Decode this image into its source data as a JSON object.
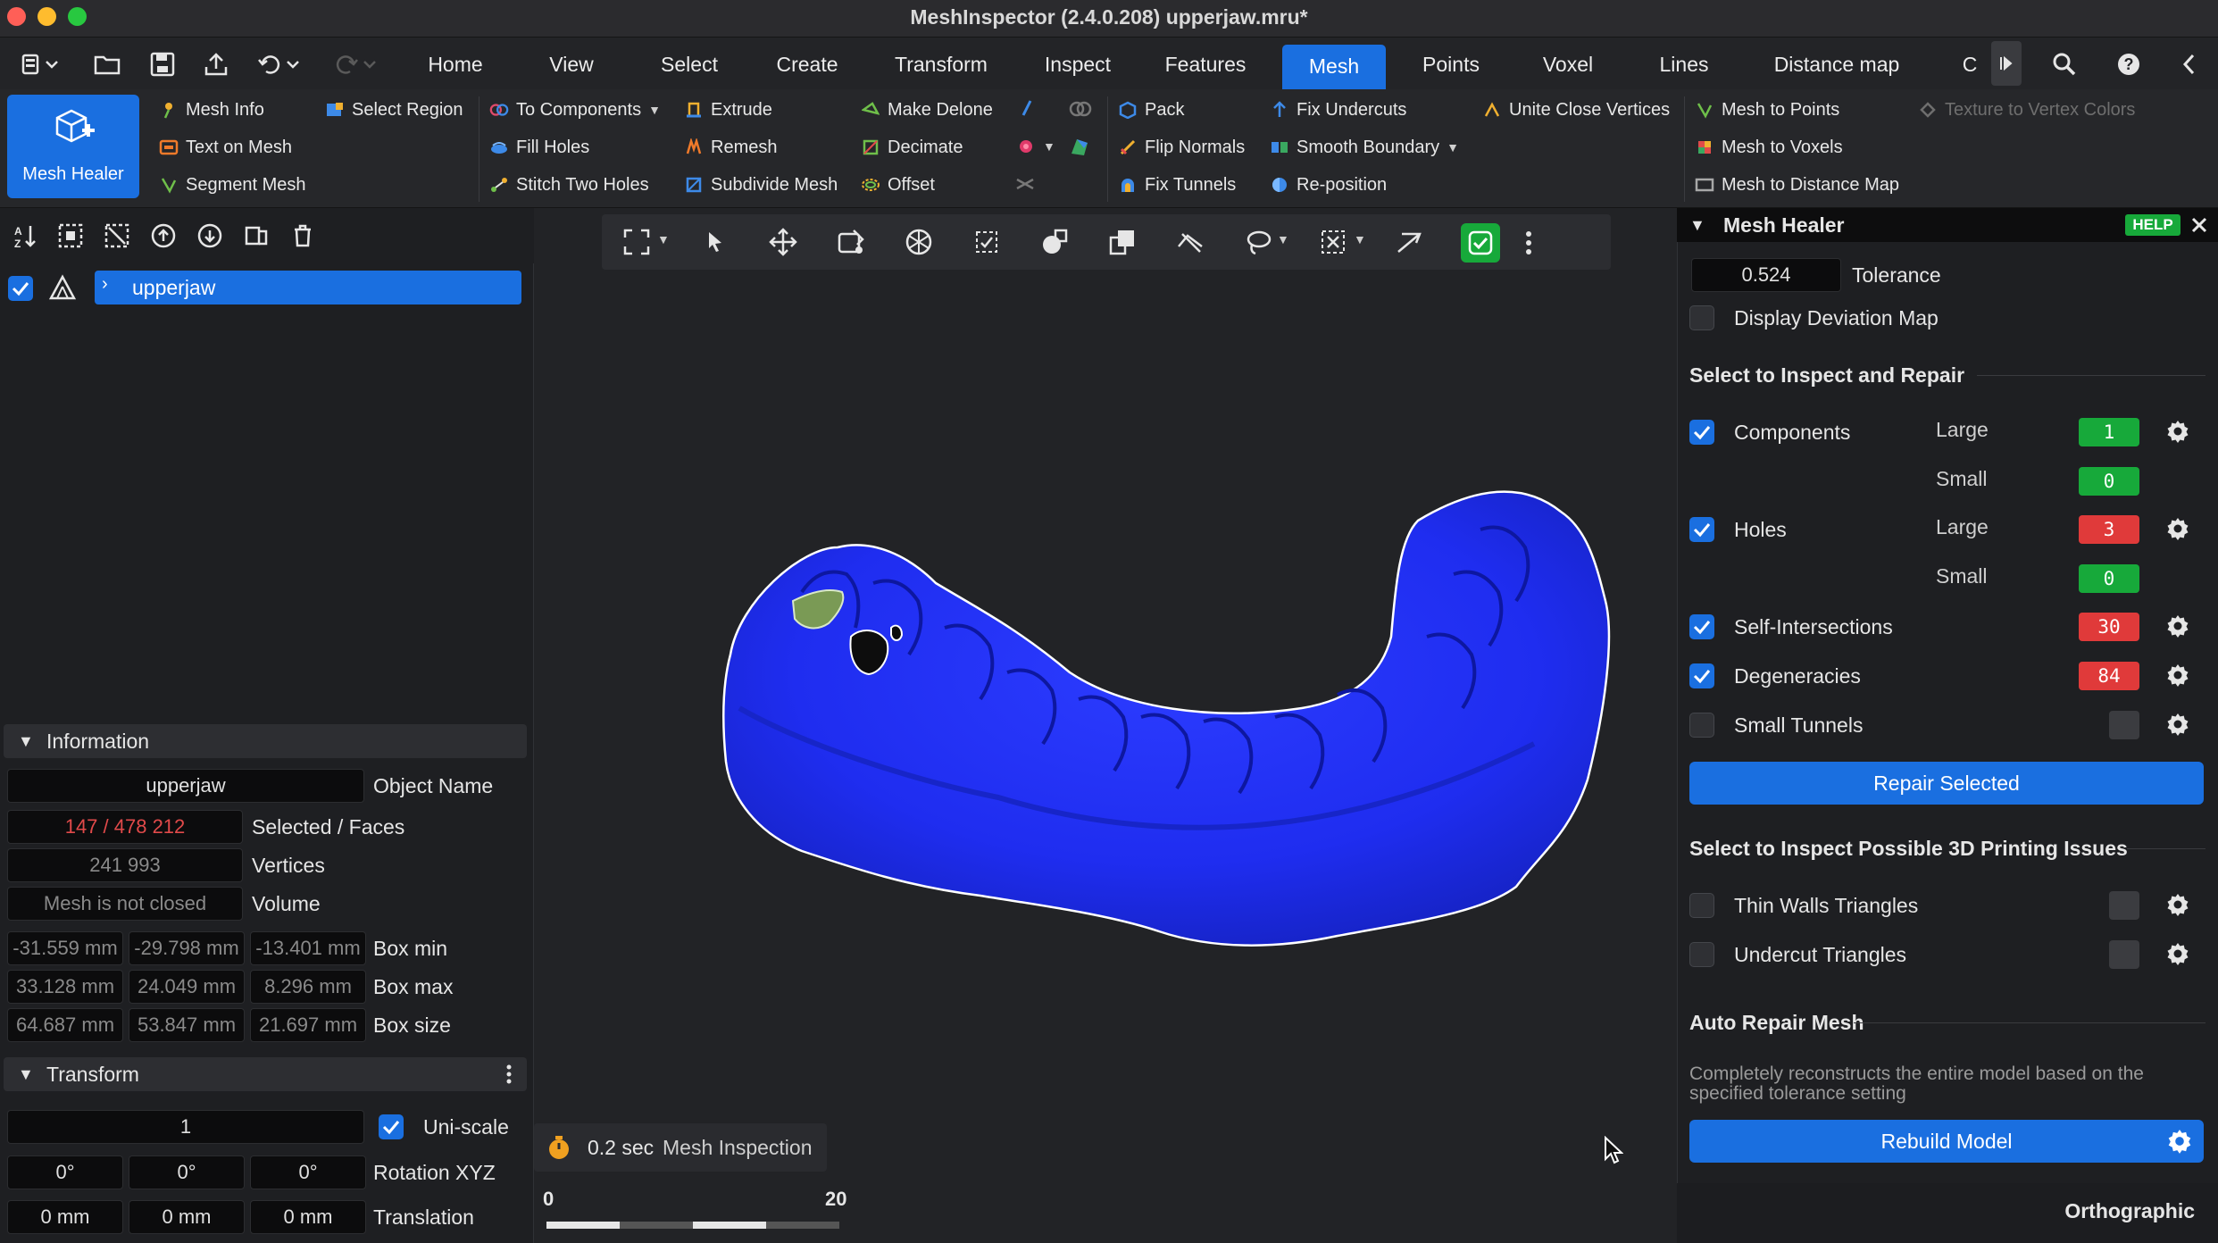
{
  "window": {
    "title": "MeshInspector (2.4.0.208) upperjaw.mru*"
  },
  "menu": {
    "tabs": [
      "Home",
      "View",
      "Select",
      "Create",
      "Transform",
      "Inspect",
      "Features",
      "Mesh",
      "Points",
      "Voxel",
      "Lines",
      "Distance map",
      "C"
    ],
    "active_tab": "Mesh"
  },
  "ribbon": {
    "big_button": "Mesh Healer",
    "mesh_info": "Mesh Info",
    "text_on_mesh": "Text on Mesh",
    "segment_mesh": "Segment Mesh",
    "select_region": "Select Region",
    "to_components": "To Components",
    "fill_holes": "Fill Holes",
    "stitch_two_holes": "Stitch Two Holes",
    "extrude": "Extrude",
    "remesh": "Remesh",
    "subdivide_mesh": "Subdivide Mesh",
    "make_delone": "Make Delone",
    "decimate": "Decimate",
    "offset": "Offset",
    "pack": "Pack",
    "flip_normals": "Flip Normals",
    "fix_tunnels": "Fix Tunnels",
    "fix_undercuts": "Fix Undercuts",
    "smooth_boundary": "Smooth Boundary",
    "reposition": "Re-position",
    "unite_close_vertices": "Unite Close Vertices",
    "mesh_to_points": "Mesh to Points",
    "mesh_to_voxels": "Mesh to Voxels",
    "mesh_to_distance_map": "Mesh to Distance Map",
    "texture_to_vertex_colors": "Texture to Vertex Colors"
  },
  "scene_tree": {
    "object": "upperjaw"
  },
  "information": {
    "header": "Information",
    "object_name_value": "upperjaw",
    "object_name_label": "Object Name",
    "selected_faces_value": "147 / 478 212",
    "selected_faces_label": "Selected / Faces",
    "vertices_value": "241 993",
    "vertices_label": "Vertices",
    "volume_value": "Mesh is not closed",
    "volume_label": "Volume",
    "box_min": [
      "-31.559 mm",
      "-29.798 mm",
      "-13.401 mm"
    ],
    "box_min_label": "Box min",
    "box_max": [
      "33.128 mm",
      "24.049 mm",
      "8.296 mm"
    ],
    "box_max_label": "Box max",
    "box_size": [
      "64.687 mm",
      "53.847 mm",
      "21.697 mm"
    ],
    "box_size_label": "Box size"
  },
  "transform": {
    "header": "Transform",
    "scale_value": "1",
    "uniscale_label": "Uni-scale",
    "rotation": [
      "0°",
      "0°",
      "0°"
    ],
    "rotation_label": "Rotation XYZ",
    "translation": [
      "0 mm",
      "0 mm",
      "0 mm"
    ],
    "translation_label": "Translation"
  },
  "viewport": {
    "timer_value": "0.2 sec",
    "timer_label": "Mesh Inspection",
    "scale_start": "0",
    "scale_end": "20",
    "projection": "Orthographic",
    "mesh_color": "#1f2df0"
  },
  "healer": {
    "title": "Mesh Healer",
    "help": "HELP",
    "tolerance_value": "0.524",
    "tolerance_label": "Tolerance",
    "display_deviation_map": "Display Deviation Map",
    "section_inspect": "Select to Inspect and Repair",
    "components": "Components",
    "holes": "Holes",
    "self_intersections": "Self-Intersections",
    "degeneracies": "Degeneracies",
    "small_tunnels": "Small Tunnels",
    "large": "Large",
    "small": "Small",
    "components_large": "1",
    "components_small": "0",
    "holes_large": "3",
    "holes_small": "0",
    "self_intersections_count": "30",
    "degeneracies_count": "84",
    "repair_selected": "Repair Selected",
    "section_printing": "Select to Inspect Possible 3D Printing Issues",
    "thin_walls": "Thin Walls Triangles",
    "undercut": "Undercut Triangles",
    "section_auto": "Auto Repair Mesh",
    "auto_desc_line1": "Completely reconstructs the entire model based on the",
    "auto_desc_line2": "specified tolerance setting",
    "rebuild_model": "Rebuild Model"
  },
  "colors": {
    "accent": "#1a6fe0",
    "ok": "#17a93a",
    "error": "#e03a3a"
  }
}
